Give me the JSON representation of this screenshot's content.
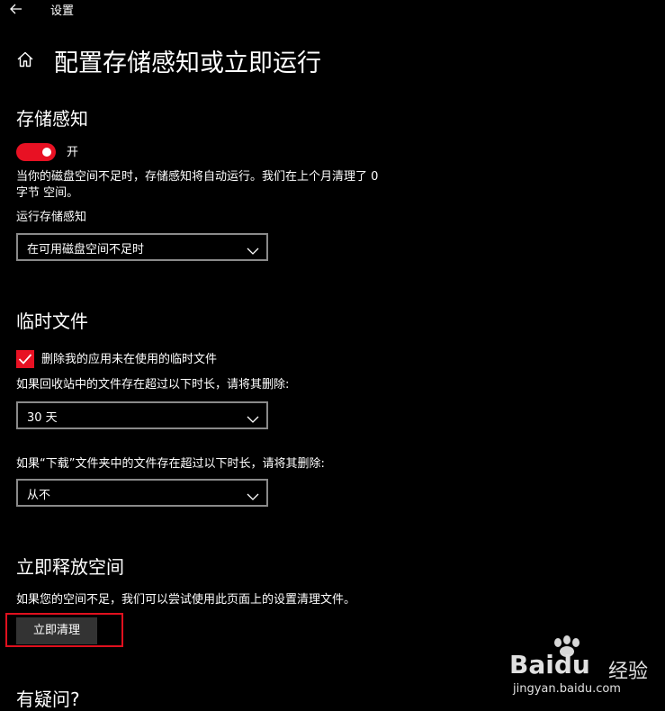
{
  "window": {
    "title": "设置"
  },
  "page": {
    "title": "配置存储感知或立即运行"
  },
  "storage_sense": {
    "heading": "存储感知",
    "toggle_label": "开",
    "toggle_on": true,
    "description_line1": "当你的磁盘空间不足时，存储感知将自动运行。我们在上个月清理了 0",
    "description_line2": "字节 空间。",
    "run_label": "运行存储感知",
    "run_value": "在可用磁盘空间不足时"
  },
  "temp_files": {
    "heading": "临时文件",
    "checkbox_label": "删除我的应用未在使用的临时文件",
    "checkbox_checked": true,
    "recycle_label": "如果回收站中的文件存在超过以下时长，请将其删除:",
    "recycle_value": "30 天",
    "downloads_label": "如果“下载”文件夹中的文件存在超过以下时长，请将其删除:",
    "downloads_value": "从不"
  },
  "free_space": {
    "heading": "立即释放空间",
    "description": "如果您的空间不足，我们可以尝试使用此页面上的设置清理文件。",
    "button_label": "立即清理"
  },
  "questions": {
    "heading": "有疑问?"
  },
  "watermark": {
    "brand": "Baidu",
    "brand_suffix": "经验",
    "url": "jingyan.baidu.com"
  },
  "colors": {
    "accent": "#e81123",
    "background": "#000000",
    "highlight": "#e0101e"
  }
}
